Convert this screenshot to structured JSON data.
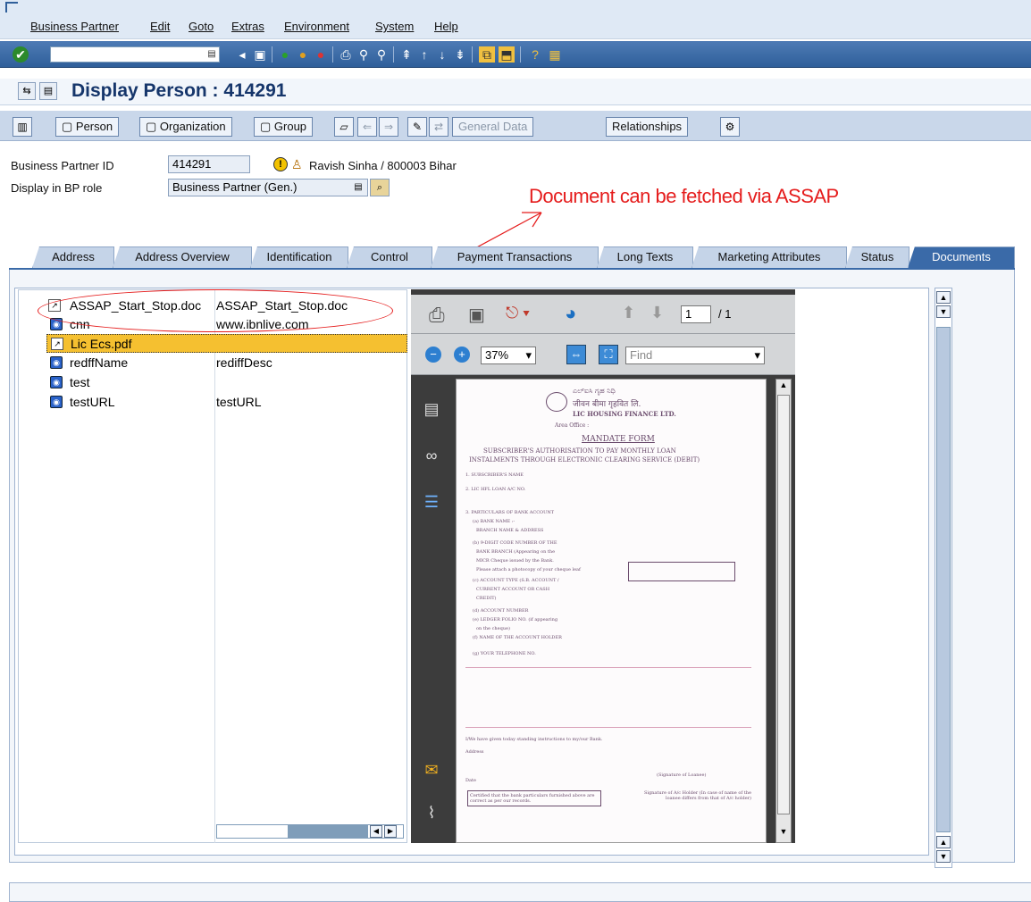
{
  "menu": [
    "Business Partner",
    "Edit",
    "Goto",
    "Extras",
    "Environment",
    "System",
    "Help"
  ],
  "window": {
    "title": "Display Person : 414291"
  },
  "app_toolbar": {
    "person": "Person",
    "organization": "Organization",
    "group": "Group",
    "general_data": "General Data",
    "relationships": "Relationships"
  },
  "header": {
    "bp_id_label": "Business Partner ID",
    "bp_id_value": "414291",
    "bp_name": "Ravish Sinha / 800003 Bihar",
    "role_label": "Display in BP role",
    "role_value": "Business Partner (Gen.)"
  },
  "annotation": "Document can be fetched via ASSAP",
  "tabs": [
    "Address",
    "Address Overview",
    "Identification",
    "Control",
    "Payment Transactions",
    "Long Texts",
    "Marketing Attributes",
    "Status",
    "Documents"
  ],
  "active_tab": "Documents",
  "documents": [
    {
      "name": "ASSAP_Start_Stop.doc",
      "desc": "ASSAP_Start_Stop.doc",
      "icon": "doc-icon"
    },
    {
      "name": "cnn",
      "desc": "www.ibnlive.com",
      "icon": "url-icon"
    },
    {
      "name": "Lic Ecs.pdf",
      "desc": "",
      "icon": "doc-icon",
      "selected": true
    },
    {
      "name": "redffName",
      "desc": "rediffDesc",
      "icon": "url-icon"
    },
    {
      "name": "test",
      "desc": "",
      "icon": "url-icon"
    },
    {
      "name": "testURL",
      "desc": "testURL",
      "icon": "url-icon"
    }
  ],
  "pdf": {
    "page": "1",
    "total": "/ 1",
    "zoom": "37%",
    "find_placeholder": "Find",
    "page_text": {
      "org1": "ಎಲ್ಐಸಿ ಗೃಹ ನಿಧಿ",
      "org2": "जीवन बीमा गृहवित लि.",
      "org3": "LIC HOUSING FINANCE LTD.",
      "area": "Area Office :",
      "heading": "MANDATE FORM",
      "sub1": "SUBSCRIBER'S AUTHORISATION TO PAY MONTHLY LOAN",
      "sub2": "INSTALMENTS THROUGH ELECTRONIC CLEARING SERVICE (DEBIT)",
      "l1": "1. SUBSCRIBER'S NAME",
      "l2": "2. LIC HFL LOAN A/C NO.",
      "l3": "3. PARTICULARS OF BANK ACCOUNT",
      "l4": "(a) BANK NAME :-",
      "l5": "BRANCH NAME & ADDRESS",
      "l6": "(b) 9-DIGIT CODE NUMBER OF THE",
      "l7": "BANK BRANCH (Appearing on the",
      "l8": "MICR Cheque issued by the Bank.",
      "l9": "Please attach a photocopy of your cheque leaf",
      "l10": "(c) ACCOUNT TYPE (S.B. ACCOUNT /",
      "l11": "CURRENT ACCOUNT OR CASH",
      "l12": "CREDIT)",
      "l13": "(d) ACCOUNT NUMBER",
      "l14": "(e) LEDGER FOLIO NO. (if appearing",
      "l15": "on the cheque)",
      "l16": "(f) NAME OF THE ACCOUNT HOLDER",
      "l17": "(g) YOUR TELEPHONE NO.",
      "l18": "I/We have given today standing instructions to my/our Bank.",
      "l19": "Address",
      "l20": "Date",
      "l21": "(Signature of Loanee)",
      "l22": "Certified that the bank particulars furnished above are correct as per our records.",
      "l23": "Signature of A/c Holder (In case of name of the loanee differs from that of A/c holder)"
    }
  }
}
